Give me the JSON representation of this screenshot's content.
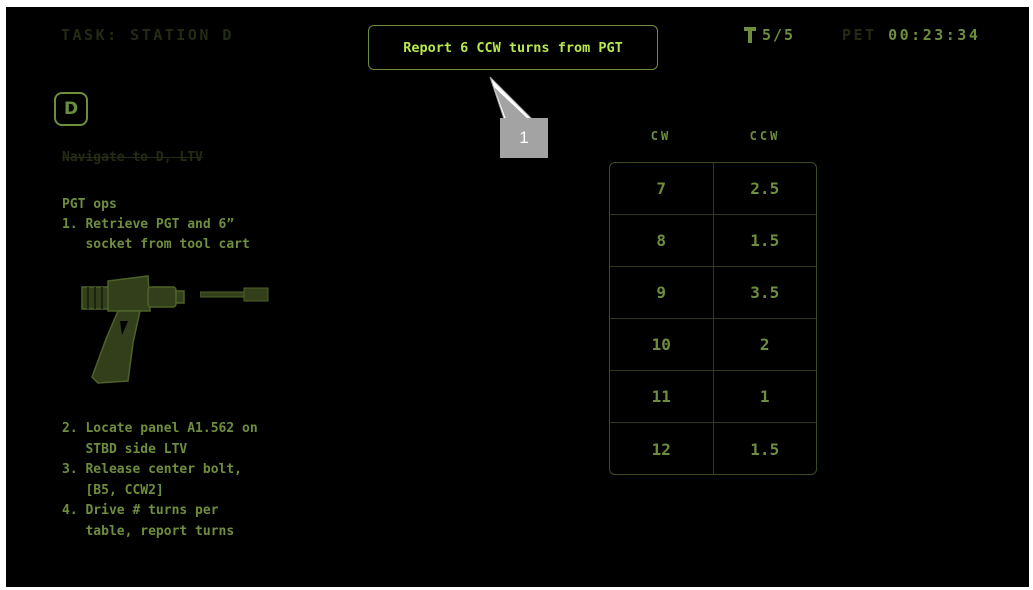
{
  "header": {
    "task_label": "TASK: STATION D",
    "callout_text": "Report 6 CCW turns from PGT",
    "step_counter": "5/5",
    "pet_label": "PET",
    "pet_time": "00:23:34"
  },
  "step": {
    "letter": "D",
    "completed_text": "Navigate to D, LTV",
    "ops_title": "PGT ops",
    "items_a": [
      "1. Retrieve PGT and 6”",
      "   socket from tool cart"
    ],
    "items_b": [
      "2. Locate panel A1.562 on",
      "   STBD side LTV",
      "3. Release center bolt,",
      "   [B5, CCW2]",
      "4. Drive # turns per",
      "   table, report turns"
    ]
  },
  "annotation": {
    "badge": "1"
  },
  "table": {
    "headers": [
      "CW",
      "CCW"
    ],
    "rows": [
      [
        "7",
        "2.5"
      ],
      [
        "8",
        "1.5"
      ],
      [
        "9",
        "3.5"
      ],
      [
        "10",
        "2"
      ],
      [
        "11",
        "1"
      ],
      [
        "12",
        "1.5"
      ]
    ]
  },
  "icons": [
    "hammer-icon",
    "pistol-grip-tool-icon",
    "socket-extension-icon"
  ],
  "colors": {
    "background": "#000000",
    "accent": "#6f8d3e",
    "highlight": "#b7e84f",
    "dim": "#242b13",
    "badge": "#a3a3a3"
  }
}
